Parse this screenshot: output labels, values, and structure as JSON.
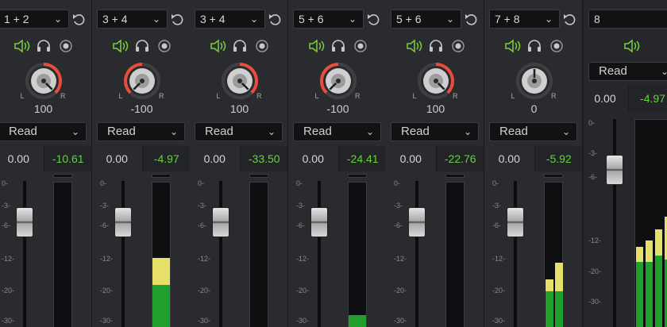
{
  "strips": [
    {
      "route": "1 + 2",
      "pan": "100",
      "pan_level": 1.0,
      "automation": "Read",
      "volume": "0.00",
      "level": "-10.61",
      "meters": []
    },
    {
      "route": "3 + 4",
      "pan": "-100",
      "pan_level": -1.0,
      "automation": "Read",
      "volume": "0.00",
      "level": "-4.97",
      "meters": [
        {
          "green": 0.31,
          "yellow": 0.18
        }
      ]
    },
    {
      "route": "3 + 4",
      "pan": "100",
      "pan_level": 1.0,
      "automation": "Read",
      "volume": "0.00",
      "level": "-33.50",
      "meters": []
    },
    {
      "route": "5 + 6",
      "pan": "-100",
      "pan_level": -1.0,
      "automation": "Read",
      "volume": "0.00",
      "level": "-24.41",
      "meters": [
        {
          "green": 0.11,
          "yellow": 0
        }
      ]
    },
    {
      "route": "5 + 6",
      "pan": "100",
      "pan_level": 1.0,
      "automation": "Read",
      "volume": "0.00",
      "level": "-22.76",
      "meters": []
    },
    {
      "route": "7 + 8",
      "pan": "0",
      "pan_level": 0.0,
      "automation": "Read",
      "volume": "0.00",
      "level": "-5.92",
      "meters": [
        {
          "green": 0.27,
          "yellow": 0.08
        },
        {
          "green": 0.27,
          "yellow": 0.19
        }
      ]
    }
  ],
  "last_strip": {
    "route": "8",
    "automation": "Read",
    "volume": "0.00",
    "level": "-4.97"
  },
  "labels": {
    "L": "L",
    "R": "R",
    "chevron": "⌄"
  },
  "scale_ticks": [
    "0-",
    "-3-",
    "-6-",
    "-12-",
    "-20-",
    "-30-"
  ],
  "colors": {
    "pan_arc": "#e84c3d",
    "level_text": "#66d141",
    "meter_green": "#1fa02c",
    "meter_yellow": "#e6e06a",
    "icon_green": "#7ad03f"
  },
  "icons": [
    "speaker-icon",
    "headphones-icon",
    "record-icon",
    "reset-icon"
  ]
}
